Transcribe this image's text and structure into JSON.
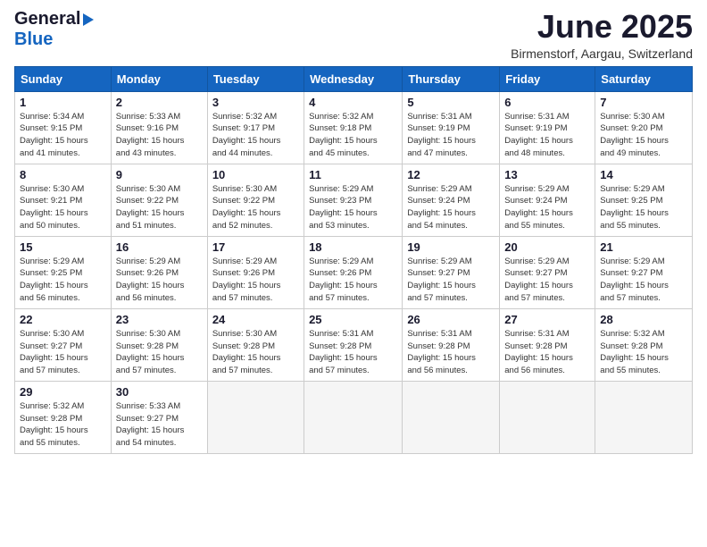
{
  "logo": {
    "general": "General",
    "blue": "Blue"
  },
  "title": "June 2025",
  "subtitle": "Birmenstorf, Aargau, Switzerland",
  "calendar": {
    "headers": [
      "Sunday",
      "Monday",
      "Tuesday",
      "Wednesday",
      "Thursday",
      "Friday",
      "Saturday"
    ],
    "weeks": [
      [
        {
          "day": "1",
          "info": "Sunrise: 5:34 AM\nSunset: 9:15 PM\nDaylight: 15 hours\nand 41 minutes."
        },
        {
          "day": "2",
          "info": "Sunrise: 5:33 AM\nSunset: 9:16 PM\nDaylight: 15 hours\nand 43 minutes."
        },
        {
          "day": "3",
          "info": "Sunrise: 5:32 AM\nSunset: 9:17 PM\nDaylight: 15 hours\nand 44 minutes."
        },
        {
          "day": "4",
          "info": "Sunrise: 5:32 AM\nSunset: 9:18 PM\nDaylight: 15 hours\nand 45 minutes."
        },
        {
          "day": "5",
          "info": "Sunrise: 5:31 AM\nSunset: 9:19 PM\nDaylight: 15 hours\nand 47 minutes."
        },
        {
          "day": "6",
          "info": "Sunrise: 5:31 AM\nSunset: 9:19 PM\nDaylight: 15 hours\nand 48 minutes."
        },
        {
          "day": "7",
          "info": "Sunrise: 5:30 AM\nSunset: 9:20 PM\nDaylight: 15 hours\nand 49 minutes."
        }
      ],
      [
        {
          "day": "8",
          "info": "Sunrise: 5:30 AM\nSunset: 9:21 PM\nDaylight: 15 hours\nand 50 minutes."
        },
        {
          "day": "9",
          "info": "Sunrise: 5:30 AM\nSunset: 9:22 PM\nDaylight: 15 hours\nand 51 minutes."
        },
        {
          "day": "10",
          "info": "Sunrise: 5:30 AM\nSunset: 9:22 PM\nDaylight: 15 hours\nand 52 minutes."
        },
        {
          "day": "11",
          "info": "Sunrise: 5:29 AM\nSunset: 9:23 PM\nDaylight: 15 hours\nand 53 minutes."
        },
        {
          "day": "12",
          "info": "Sunrise: 5:29 AM\nSunset: 9:24 PM\nDaylight: 15 hours\nand 54 minutes."
        },
        {
          "day": "13",
          "info": "Sunrise: 5:29 AM\nSunset: 9:24 PM\nDaylight: 15 hours\nand 55 minutes."
        },
        {
          "day": "14",
          "info": "Sunrise: 5:29 AM\nSunset: 9:25 PM\nDaylight: 15 hours\nand 55 minutes."
        }
      ],
      [
        {
          "day": "15",
          "info": "Sunrise: 5:29 AM\nSunset: 9:25 PM\nDaylight: 15 hours\nand 56 minutes."
        },
        {
          "day": "16",
          "info": "Sunrise: 5:29 AM\nSunset: 9:26 PM\nDaylight: 15 hours\nand 56 minutes."
        },
        {
          "day": "17",
          "info": "Sunrise: 5:29 AM\nSunset: 9:26 PM\nDaylight: 15 hours\nand 57 minutes."
        },
        {
          "day": "18",
          "info": "Sunrise: 5:29 AM\nSunset: 9:26 PM\nDaylight: 15 hours\nand 57 minutes."
        },
        {
          "day": "19",
          "info": "Sunrise: 5:29 AM\nSunset: 9:27 PM\nDaylight: 15 hours\nand 57 minutes."
        },
        {
          "day": "20",
          "info": "Sunrise: 5:29 AM\nSunset: 9:27 PM\nDaylight: 15 hours\nand 57 minutes."
        },
        {
          "day": "21",
          "info": "Sunrise: 5:29 AM\nSunset: 9:27 PM\nDaylight: 15 hours\nand 57 minutes."
        }
      ],
      [
        {
          "day": "22",
          "info": "Sunrise: 5:30 AM\nSunset: 9:27 PM\nDaylight: 15 hours\nand 57 minutes."
        },
        {
          "day": "23",
          "info": "Sunrise: 5:30 AM\nSunset: 9:28 PM\nDaylight: 15 hours\nand 57 minutes."
        },
        {
          "day": "24",
          "info": "Sunrise: 5:30 AM\nSunset: 9:28 PM\nDaylight: 15 hours\nand 57 minutes."
        },
        {
          "day": "25",
          "info": "Sunrise: 5:31 AM\nSunset: 9:28 PM\nDaylight: 15 hours\nand 57 minutes."
        },
        {
          "day": "26",
          "info": "Sunrise: 5:31 AM\nSunset: 9:28 PM\nDaylight: 15 hours\nand 56 minutes."
        },
        {
          "day": "27",
          "info": "Sunrise: 5:31 AM\nSunset: 9:28 PM\nDaylight: 15 hours\nand 56 minutes."
        },
        {
          "day": "28",
          "info": "Sunrise: 5:32 AM\nSunset: 9:28 PM\nDaylight: 15 hours\nand 55 minutes."
        }
      ],
      [
        {
          "day": "29",
          "info": "Sunrise: 5:32 AM\nSunset: 9:28 PM\nDaylight: 15 hours\nand 55 minutes."
        },
        {
          "day": "30",
          "info": "Sunrise: 5:33 AM\nSunset: 9:27 PM\nDaylight: 15 hours\nand 54 minutes."
        },
        {
          "day": "",
          "info": ""
        },
        {
          "day": "",
          "info": ""
        },
        {
          "day": "",
          "info": ""
        },
        {
          "day": "",
          "info": ""
        },
        {
          "day": "",
          "info": ""
        }
      ]
    ]
  }
}
